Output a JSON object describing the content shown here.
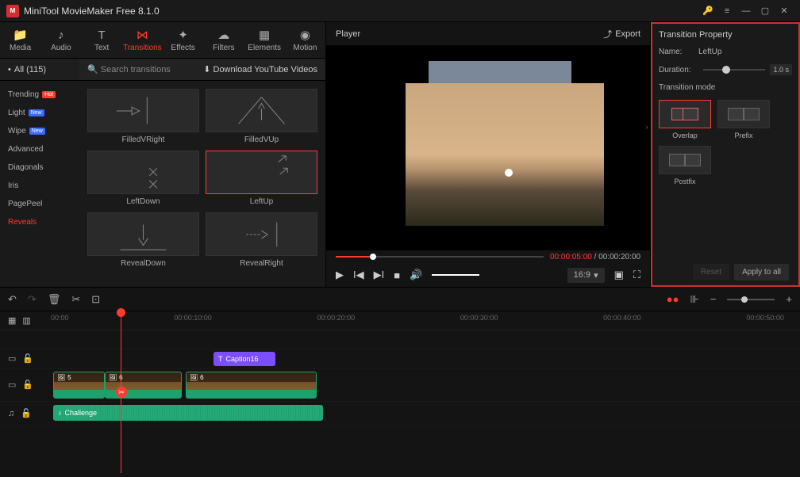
{
  "app": {
    "title": "MiniTool MovieMaker Free 8.1.0"
  },
  "tabs": [
    {
      "label": "Media",
      "icon": "folder"
    },
    {
      "label": "Audio",
      "icon": "music"
    },
    {
      "label": "Text",
      "icon": "T"
    },
    {
      "label": "Transitions",
      "icon": "bowtie",
      "active": true
    },
    {
      "label": "Effects",
      "icon": "sparkle"
    },
    {
      "label": "Filters",
      "icon": "cloud"
    },
    {
      "label": "Elements",
      "icon": "grid"
    },
    {
      "label": "Motion",
      "icon": "swirl"
    }
  ],
  "category_selector": "All (115)",
  "search_placeholder": "Search transitions",
  "download_label": "Download YouTube Videos",
  "categories": [
    {
      "label": "Trending",
      "badge": "Hot",
      "badgeColor": "red"
    },
    {
      "label": "Light",
      "badge": "New",
      "badgeColor": "blue"
    },
    {
      "label": "Wipe",
      "badge": "New",
      "badgeColor": "blue"
    },
    {
      "label": "Advanced"
    },
    {
      "label": "Diagonals"
    },
    {
      "label": "Iris"
    },
    {
      "label": "PagePeel"
    },
    {
      "label": "Reveals",
      "active": true
    }
  ],
  "transitions": [
    {
      "name": "FilledVRight"
    },
    {
      "name": "FilledVUp"
    },
    {
      "name": "LeftDown"
    },
    {
      "name": "LeftUp",
      "selected": true
    },
    {
      "name": "RevealDown"
    },
    {
      "name": "RevealRight"
    }
  ],
  "player": {
    "title": "Player",
    "export": "Export",
    "current_time": "00:00:05:00",
    "total_time": "00:00:20:00",
    "aspect": "16:9"
  },
  "property": {
    "panel_title": "Transition Property",
    "name_label": "Name:",
    "name_value": "LeftUp",
    "duration_label": "Duration:",
    "duration_value": "1.0 s",
    "mode_label": "Transition mode",
    "modes": [
      {
        "label": "Overlap",
        "selected": true
      },
      {
        "label": "Prefix"
      },
      {
        "label": "Postfix"
      }
    ],
    "reset": "Reset",
    "apply": "Apply to all"
  },
  "timeline": {
    "ruler": [
      "00:00",
      "00:00:10:00",
      "00:00:20:00",
      "00:00:30:00",
      "00:00:40:00",
      "00:00:50:00"
    ],
    "caption_clip": "Caption16",
    "video_clip1_frames": "5",
    "video_clip2_frames": "6",
    "video_clip3_frames": "6",
    "audio_clip": "Challenge"
  }
}
